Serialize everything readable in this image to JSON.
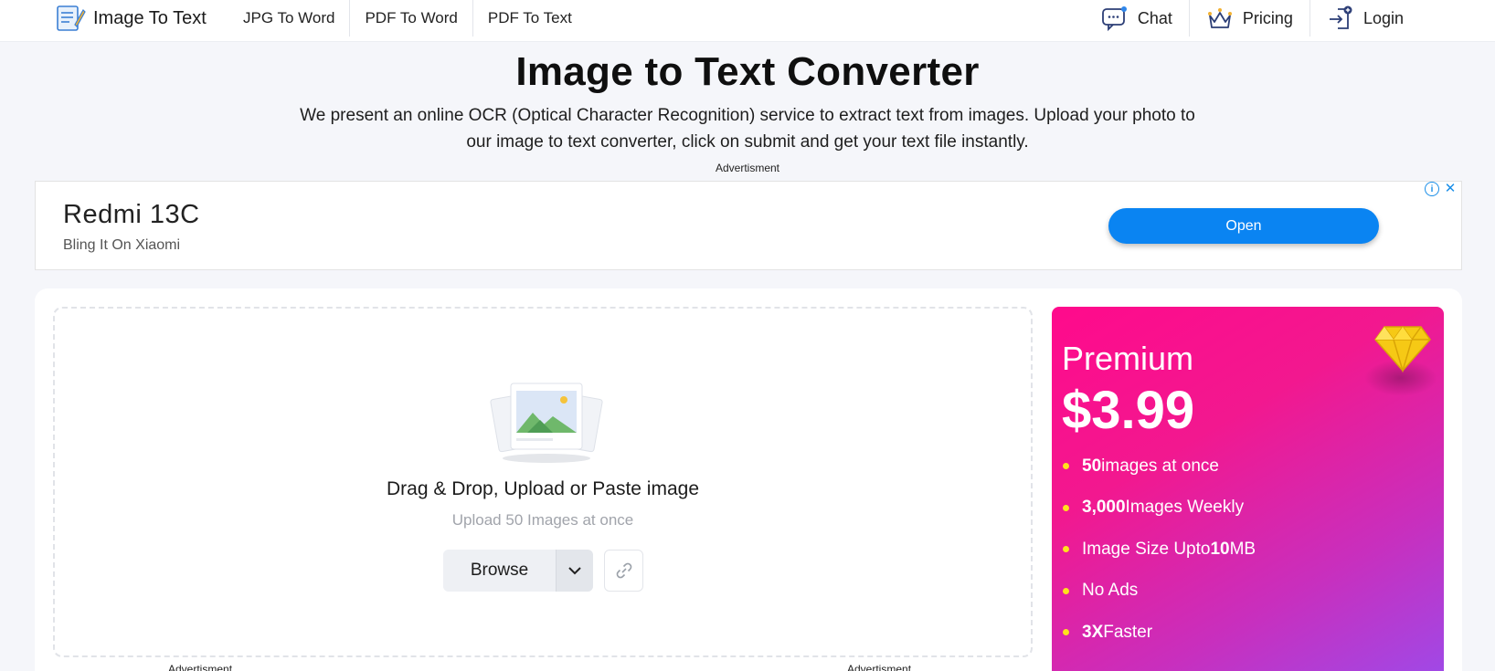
{
  "nav": {
    "brand": "Image To Text",
    "links": [
      "JPG To Word",
      "PDF To Word",
      "PDF To Text"
    ],
    "chat": "Chat",
    "pricing": "Pricing",
    "login": "Login"
  },
  "hero": {
    "title": "Image to Text Converter",
    "description": "We present an online OCR (Optical Character Recognition) service to extract text from images. Upload your photo to our image to text converter, click on submit and get your text file instantly.",
    "ad_label": "Advertisment"
  },
  "ad": {
    "title": "Redmi 13C",
    "subtitle": "Bling It On Xiaomi",
    "button": "Open"
  },
  "upload": {
    "title": "Drag & Drop, Upload or Paste image",
    "subtitle": "Upload 50 Images at once",
    "browse": "Browse",
    "ad_label_left": "Advertisment",
    "ad_label_right": "Advertisment"
  },
  "premium": {
    "name": "Premium",
    "price": "$3.99",
    "features": [
      {
        "bold": "50",
        "text": " images at once"
      },
      {
        "bold": "3,000",
        "text": " Images Weekly"
      },
      {
        "pre": "Image Size Upto ",
        "bold": "10",
        "text": " MB"
      },
      {
        "text": "No Ads"
      },
      {
        "bold": "3X",
        "text": " Faster"
      }
    ]
  },
  "colors": {
    "accent_blue": "#0a84f2",
    "premium_pink": "#ff0a8c",
    "premium_purple": "#9c4bea",
    "bullet_yellow": "#ffe21c"
  }
}
